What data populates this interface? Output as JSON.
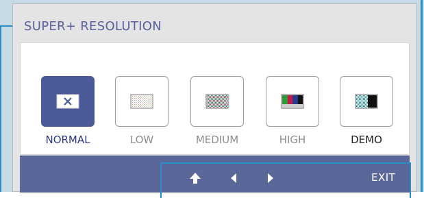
{
  "osd": {
    "title": "SUPER+ RESOLUTION",
    "modes": [
      {
        "label": "NORMAL",
        "selected": true
      },
      {
        "label": "LOW",
        "selected": false
      },
      {
        "label": "MEDIUM",
        "selected": false
      },
      {
        "label": "HIGH",
        "selected": false
      },
      {
        "label": "DEMO",
        "selected": false
      }
    ]
  },
  "footer": {
    "exit_label": "EXIT",
    "keys": [
      "up-arrow-icon",
      "left-arrow-icon",
      "right-arrow-icon"
    ]
  },
  "colors": {
    "accent": "#4c5a9a",
    "footer_bg": "#5c6799",
    "highlight_border": "#2a8ec8",
    "title_text": "#5a5fa0"
  }
}
